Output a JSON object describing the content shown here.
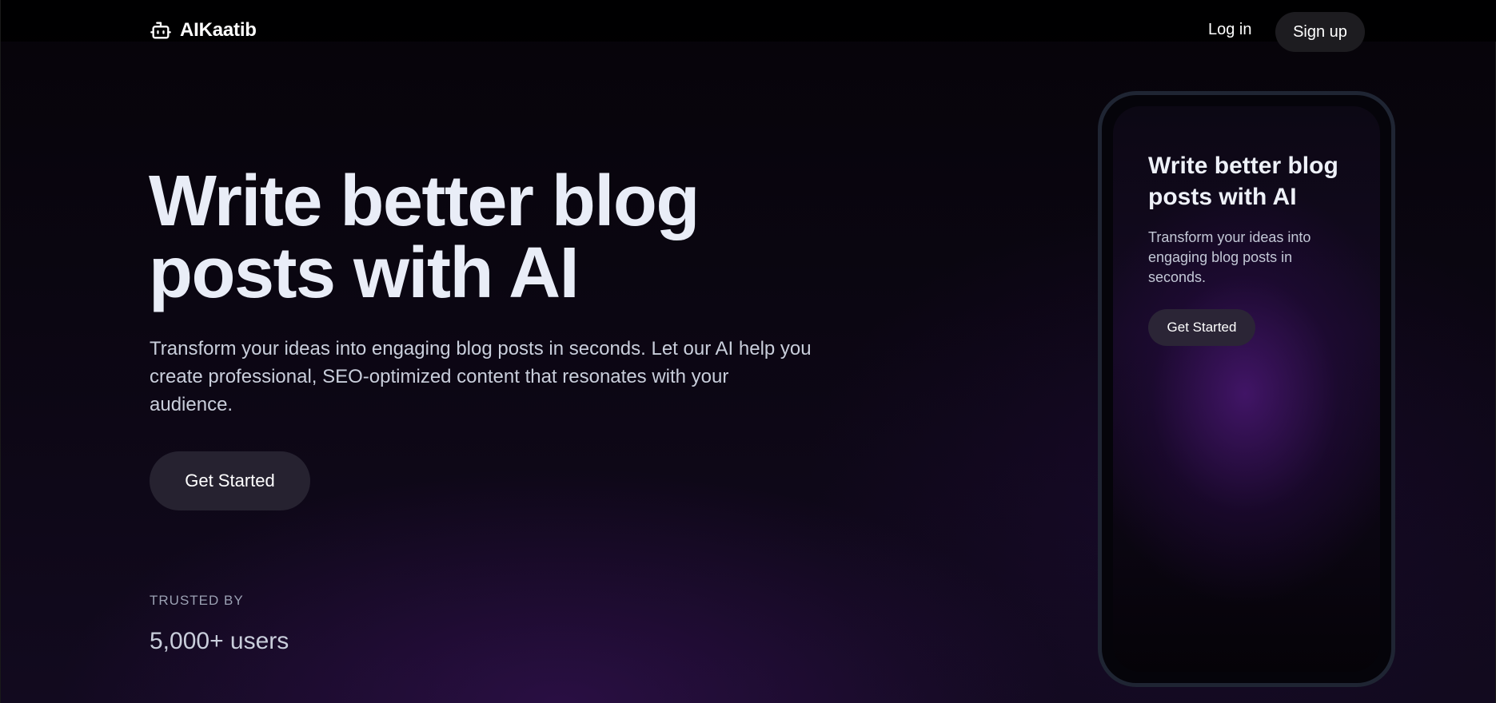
{
  "nav": {
    "brand": "AIKaatib",
    "brand_icon": "robot-icon",
    "login_label": "Log in",
    "signup_label": "Sign up"
  },
  "hero": {
    "title": "Write better blog posts with AI",
    "subtitle": "Transform your ideas into engaging blog posts in seconds. Let our AI help you create professional, SEO-optimized content that resonates with your audience.",
    "cta_label": "Get Started"
  },
  "trusted": {
    "label": "TRUSTED BY",
    "value": "5,000+ users"
  },
  "phone_preview": {
    "title": "Write better blog posts with AI",
    "subtitle": "Transform your ideas into engaging blog posts in seconds.",
    "cta_label": "Get Started"
  },
  "colors": {
    "background": "#0b0612",
    "accent_glow": "#46166e",
    "button_bg": "#262230",
    "text_primary": "#e9edf7"
  }
}
